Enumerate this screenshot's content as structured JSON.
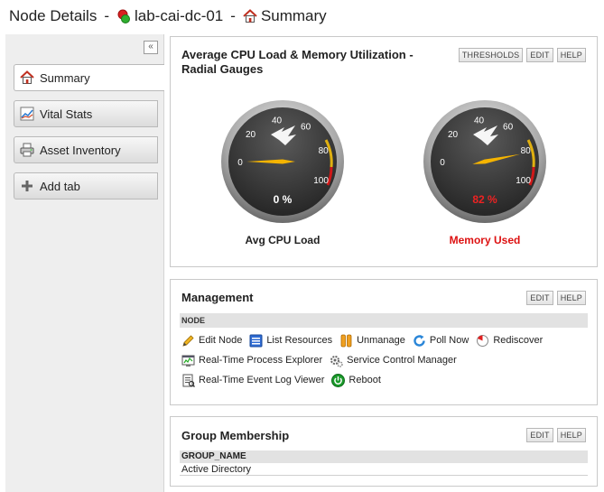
{
  "header": {
    "title": "Node Details",
    "separator": "-",
    "node_name": "lab-cai-dc-01",
    "view_name": "Summary"
  },
  "sidebar": {
    "collapse_glyph": "«",
    "tabs": [
      {
        "label": "Summary",
        "icon": "home-icon",
        "active": true
      },
      {
        "label": "Vital Stats",
        "icon": "chart-icon",
        "active": false
      },
      {
        "label": "Asset Inventory",
        "icon": "printer-icon",
        "active": false
      },
      {
        "label": "Add tab",
        "icon": "plus-icon",
        "active": false
      }
    ]
  },
  "gauges_panel": {
    "title_line1": "Average CPU Load & Memory Utilization -",
    "title_line2": "Radial Gauges",
    "buttons": {
      "thresholds": "THRESHOLDS",
      "edit": "EDIT",
      "help": "HELP"
    },
    "scale_labels": [
      "0",
      "20",
      "40",
      "60",
      "80",
      "100"
    ],
    "gauges": [
      {
        "label": "Avg CPU Load",
        "value": 0,
        "value_text": "0 %",
        "label_color": "#222222",
        "value_color": "#ffffff"
      },
      {
        "label": "Memory Used",
        "value": 82,
        "value_text": "82 %",
        "label_color": "#dd1111",
        "value_color": "#ee2222"
      }
    ]
  },
  "management_panel": {
    "title": "Management",
    "buttons": {
      "edit": "EDIT",
      "help": "HELP"
    },
    "section": "NODE",
    "actions": {
      "edit_node": "Edit Node",
      "list_resources": "List Resources",
      "unmanage": "Unmanage",
      "poll_now": "Poll Now",
      "rediscover": "Rediscover",
      "process_explorer": "Real-Time Process Explorer",
      "service_control": "Service Control Manager",
      "event_log": "Real-Time Event Log Viewer",
      "reboot": "Reboot"
    }
  },
  "group_panel": {
    "title": "Group Membership",
    "buttons": {
      "edit": "EDIT",
      "help": "HELP"
    },
    "column": "GROUP_NAME",
    "rows": [
      "Active Directory"
    ]
  },
  "colors": {
    "accent_red": "#dd1111",
    "needle": "#f5b400",
    "gauge_face": "#3a3a3a"
  }
}
